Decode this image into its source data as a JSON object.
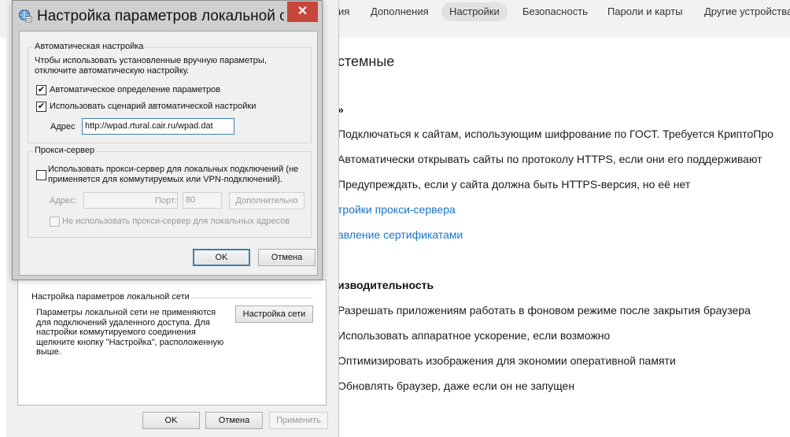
{
  "browser": {
    "tabs": [
      "ия",
      "Дополнения",
      "Настройки",
      "Безопасность",
      "Пароли и карты",
      "Другие устройства"
    ],
    "section_title": "стемные",
    "subsection_1": "»",
    "options_1": [
      "Подключаться к сайтам, использующим шифрование по ГОСТ. Требуется КриптоПро",
      "Автоматически открывать сайты по протоколу HTTPS, если они его поддерживают",
      "Предупреждать, если у сайта должна быть HTTPS-версия, но её нет"
    ],
    "links": [
      "тройки прокси-сервера",
      "авление сертификатами"
    ],
    "subsection_2": "изводительность",
    "options_2": [
      "Разрешать приложениям работать в фоновом режиме после закрытия браузера",
      "Использовать аппаратное ускорение, если возможно",
      "Оптимизировать изображения для экономии оперативной памяти",
      "Обновлять браузер, даже если он не запущен"
    ]
  },
  "inet": {
    "lan_group_label": "Настройка параметров локальной сети",
    "lan_desc": "Параметры локальной сети не применяются для подключений удаленного доступа. Для настройки коммутируемого соединения щелкните кнопку \"Настройка\", расположенную выше.",
    "lan_button": "Настройка сети",
    "ok": "OK",
    "cancel": "Отмена",
    "apply": "Применить"
  },
  "lan": {
    "title": "Настройка параметров локальной с...",
    "close": "✕",
    "auto_group": "Автоматическая настройка",
    "auto_desc": "Чтобы использовать установленные вручную параметры, отключите автоматическую настройку.",
    "auto_detect_label": "Автоматическое определение параметров",
    "auto_detect_checked": true,
    "script_label": "Использовать сценарий автоматической настройки",
    "script_checked": true,
    "address_label": "Адрес",
    "address_value": "http://wpad.rtural.cair.ru/wpad.dat",
    "proxy_group": "Прокси-сервер",
    "proxy_label": "Использовать прокси-сервер для локальных подключений (не применяется для коммутируемых или VPN-подключений).",
    "proxy_checked": false,
    "proxy_address_label": "Адрес:",
    "proxy_address_value": "",
    "port_label": "Порт:",
    "port_value": "80",
    "advanced_button": "Дополнительно",
    "bypass_label": "Не использовать прокси-сервер для локальных адресов",
    "bypass_checked": false,
    "ok": "OK",
    "cancel": "Отмена"
  },
  "colors": {
    "link": "#1a73c7",
    "close_button": "#c7463c",
    "focus_border": "#3c7fb1"
  }
}
